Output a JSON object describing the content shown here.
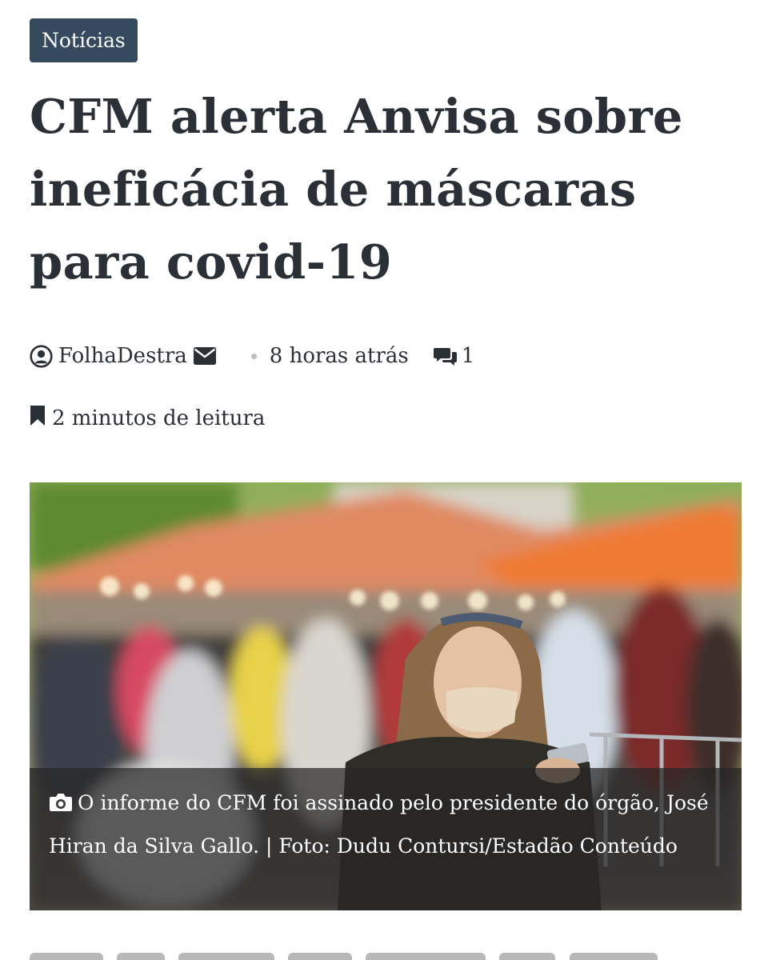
{
  "article": {
    "category": "Notícias",
    "headline": "CFM alerta Anvisa sobre ineficácia de máscaras para covid-19",
    "meta": {
      "author": "FolhaDestra",
      "author_icon": "user-circle-icon",
      "email_icon": "envelope-icon",
      "time_ago": "8 horas atrás",
      "comments_icon": "comments-icon",
      "comment_count": "1"
    },
    "reading_time": "2 minutos de leitura",
    "reading_icon": "bookmark-icon",
    "image": {
      "caption": "O informe do CFM foi assinado pelo presidente do órgão, José Hiran da Silva Gallo. | Foto: Dudu Contursi/Estadão Conteúdo",
      "caption_icon": "camera-icon"
    }
  },
  "colors": {
    "badge_bg": "#354a5f",
    "text": "#2b2f36",
    "caption_overlay": "rgba(38,38,38,0.72)"
  }
}
